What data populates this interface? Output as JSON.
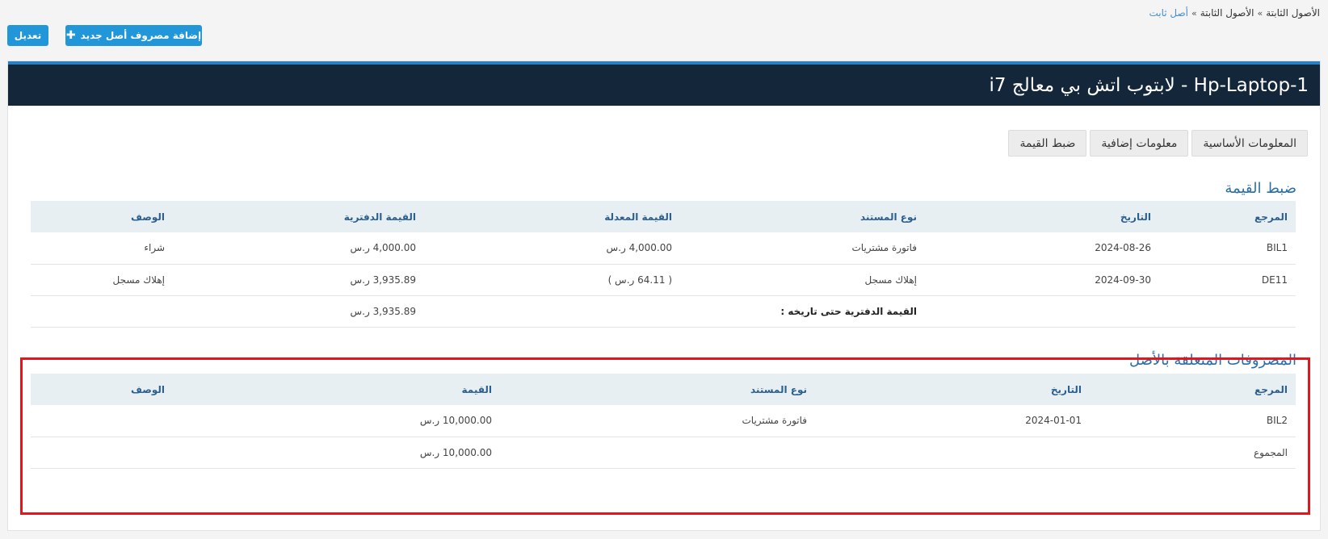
{
  "breadcrumb": [
    "الأصول الثابتة",
    "الأصول الثابتة",
    "أصل ثابت"
  ],
  "toolbar": {
    "edit_label": "تعديل",
    "add_label": "إضافة مصروف أصل جديد"
  },
  "asset": {
    "title": "Hp-Laptop-1 - لابتوب اتش بي معالج i7"
  },
  "tabs": [
    "المعلومات الأساسية",
    "معلومات إضافية",
    "ضبط القيمة"
  ],
  "value_adjustment": {
    "title": "ضبط القيمة",
    "headers": [
      "المرجع",
      "التاريخ",
      "نوع المستند",
      "القيمة المعدلة",
      "القيمة الدفترية",
      "الوصف"
    ],
    "rows": [
      [
        "BIL1",
        "2024-08-26",
        "فاتورة مشتريات",
        "4,000.00 ر.س",
        "4,000.00 ر.س",
        "شراء"
      ],
      [
        "DE11",
        "2024-09-30",
        "إهلاك مسجل",
        "( 64.11 ر.س )",
        "3,935.89 ر.س",
        "إهلاك مسجل"
      ]
    ],
    "footer_label": "القيمة الدفترية حتى تاريخه :",
    "footer_value": "3,935.89 ر.س"
  },
  "expenses": {
    "title": "المصروفات المتعلقة بالأصل",
    "headers": [
      "المرجع",
      "التاريخ",
      "نوع المستند",
      "القيمة",
      "الوصف"
    ],
    "rows": [
      [
        "BIL2",
        "2024-01-01",
        "فاتورة مشتريات",
        "10,000.00 ر.س",
        ""
      ]
    ],
    "total_label": "المجموع",
    "total_value": "10,000.00 ر.س"
  },
  "colors": {
    "primary": "#2196d8",
    "header_bg": "#13263a",
    "highlight": "#e8141a"
  }
}
